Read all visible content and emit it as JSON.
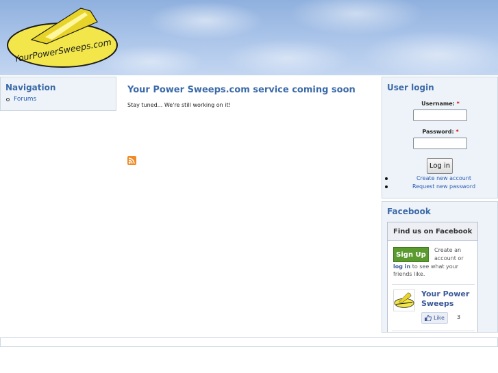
{
  "header": {
    "logo_text": "YourPowerSweeps.com"
  },
  "navigation": {
    "title": "Navigation",
    "items": [
      {
        "label": "Forums"
      }
    ]
  },
  "main": {
    "title": "Your Power Sweeps.com service coming soon",
    "body": "Stay tuned... We're still working on it!",
    "feed_icon": "rss-feed-icon"
  },
  "login": {
    "title": "User login",
    "username_label": "Username:",
    "password_label": "Password:",
    "required_mark": "*",
    "username_value": "",
    "password_value": "",
    "button_label": "Log in",
    "links": [
      {
        "label": "Create new account"
      },
      {
        "label": "Request new password"
      }
    ]
  },
  "facebook": {
    "title": "Facebook",
    "widget_header": "Find us on Facebook",
    "signup_label": "Sign Up",
    "text_line1": "Create an",
    "text_line2": "account or",
    "login_link": "log in",
    "text_line3_rest": " to see what your",
    "text_line4": "friends like.",
    "page_name_line1": "Your Power",
    "page_name_line2": "Sweeps",
    "like_label": "Like",
    "like_count": "3"
  },
  "colors": {
    "accent": "#3b6aa8",
    "link": "#2a5db0",
    "facebook_blue": "#3b5998",
    "signup_green": "#5b9a2f",
    "block_bg": "#eef3f9"
  }
}
